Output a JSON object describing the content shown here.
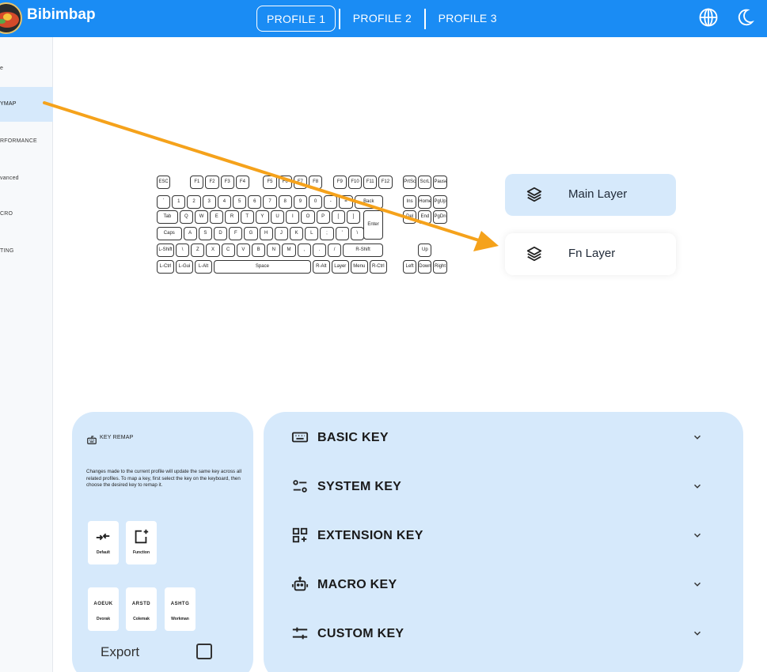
{
  "app": {
    "brand": "Bibimbap"
  },
  "header": {
    "profiles": [
      {
        "label": "PROFILE 1",
        "active": true
      },
      {
        "label": "PROFILE 2",
        "active": false
      },
      {
        "label": "PROFILE 3",
        "active": false
      }
    ],
    "icons": [
      "globe-icon",
      "moon-icon"
    ]
  },
  "sidebar": {
    "items": [
      {
        "label": "e",
        "active": false
      },
      {
        "label": "YMAP",
        "active": true
      },
      {
        "label": "RFORMANCE",
        "active": false
      },
      {
        "label": "vanced",
        "active": false
      },
      {
        "label": "CRO",
        "active": false
      },
      {
        "label": "TING",
        "active": false
      }
    ]
  },
  "keyboard": {
    "rows": [
      [
        "ESC",
        "F1",
        "F2",
        "F3",
        "F4",
        "F5",
        "F6",
        "F7",
        "F8",
        "F9",
        "F10",
        "F11",
        "F12",
        "PrtSc",
        "ScrL",
        "Pause"
      ],
      [
        "`",
        "1",
        "2",
        "3",
        "4",
        "5",
        "6",
        "7",
        "8",
        "9",
        "0",
        "-",
        "=",
        "Back",
        "Ins",
        "Home",
        "PgUp"
      ],
      [
        "Tab",
        "Q",
        "W",
        "E",
        "R",
        "T",
        "Y",
        "U",
        "I",
        "O",
        "P",
        "[",
        "]",
        "Enter",
        "Del",
        "End",
        "PgDn"
      ],
      [
        "Caps",
        "A",
        "S",
        "D",
        "F",
        "G",
        "H",
        "J",
        "K",
        "L",
        ";",
        "'",
        "\\"
      ],
      [
        "L-Shift",
        "\\",
        "Z",
        "X",
        "C",
        "V",
        "B",
        "N",
        "M",
        ",",
        ".",
        "/",
        "R-Shift",
        "Up"
      ],
      [
        "L-Ctrl",
        "L-Gui",
        "L-Alt",
        "Space",
        "R-Alt",
        "Layer",
        "Menu",
        "R-Ctrl",
        "Left",
        "Down",
        "Right"
      ]
    ]
  },
  "layers": {
    "main": {
      "label": "Main Layer",
      "icon": "layers-icon",
      "selected": true
    },
    "fn": {
      "label": "Fn Layer",
      "icon": "layers-icon",
      "selected": false
    }
  },
  "remap": {
    "title": "KEY REMAP",
    "description": "Changes made to the current profile will update the same key across all related profiles. To map a key, first select the key on the keyboard, then choose the desired key to remap it.",
    "tiles": [
      {
        "symbol": "",
        "caption": "Default",
        "icon": "default-arrows-icon"
      },
      {
        "symbol": "",
        "caption": "Function",
        "icon": "add-box-icon"
      },
      {
        "symbol": "AOEUK",
        "caption": "Dvorak"
      },
      {
        "symbol": "ARSTD",
        "caption": "Colemak"
      },
      {
        "symbol": "ASHTG",
        "caption": "Workman"
      }
    ],
    "export_label": "Export",
    "export_checked": false
  },
  "categories": [
    {
      "label": "BASIC KEY",
      "icon": "keyboard-icon"
    },
    {
      "label": "SYSTEM KEY",
      "icon": "sliders-icon"
    },
    {
      "label": "EXTENSION KEY",
      "icon": "grid-add-icon"
    },
    {
      "label": "MACRO KEY",
      "icon": "robot-icon"
    },
    {
      "label": "CUSTOM KEY",
      "icon": "tune-icon"
    }
  ],
  "colors": {
    "accent": "#1a8cf4",
    "panel": "#d6e9fb",
    "annotation_arrow": "#f5a21b"
  }
}
